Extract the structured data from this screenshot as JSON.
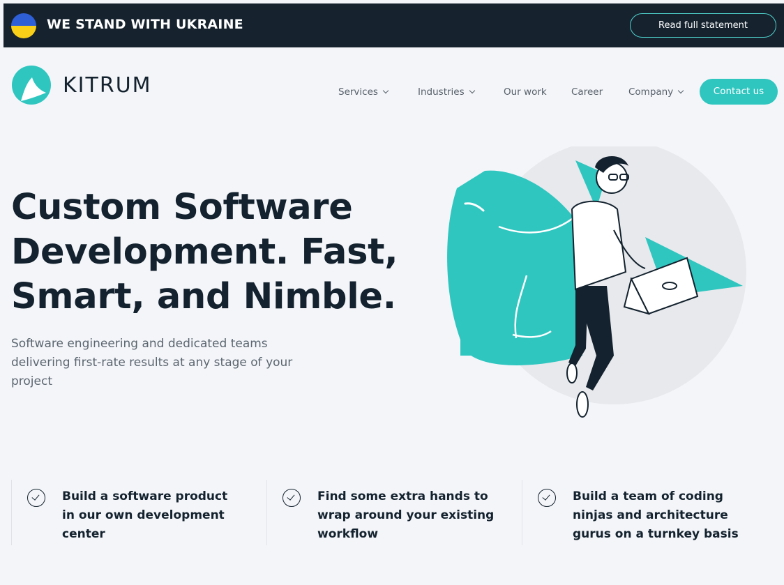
{
  "banner": {
    "text": "WE STAND WITH UKRAINE",
    "button_label": "Read full statement",
    "flag_colors": {
      "top": "#2f5fd6",
      "bottom": "#f9cf18"
    },
    "background": "#16232f"
  },
  "header": {
    "brand": "KITRUM",
    "nav": [
      {
        "label": "Services",
        "dropdown": true
      },
      {
        "label": "Industries",
        "dropdown": true
      },
      {
        "label": "Our work",
        "dropdown": false
      },
      {
        "label": "Career",
        "dropdown": false
      },
      {
        "label": "Company",
        "dropdown": true
      }
    ],
    "cta_label": "Contact us",
    "accent_color": "#2fc6c0"
  },
  "hero": {
    "title_lines": [
      "Custom Software",
      "Development. Fast,",
      "Smart, and Nimble."
    ],
    "subtitle": "Software engineering and dedicated teams delivering first-rate results at any stage of your project",
    "illustration": "shark-with-developer-illustration"
  },
  "features": [
    {
      "icon": "check-circle-icon",
      "text": "Build a software product in our own development center"
    },
    {
      "icon": "check-circle-icon",
      "text": "Find some extra hands to wrap around your existing workflow"
    },
    {
      "icon": "check-circle-icon",
      "text": "Build a team of coding ninjas and architecture gurus on a turnkey basis"
    }
  ]
}
